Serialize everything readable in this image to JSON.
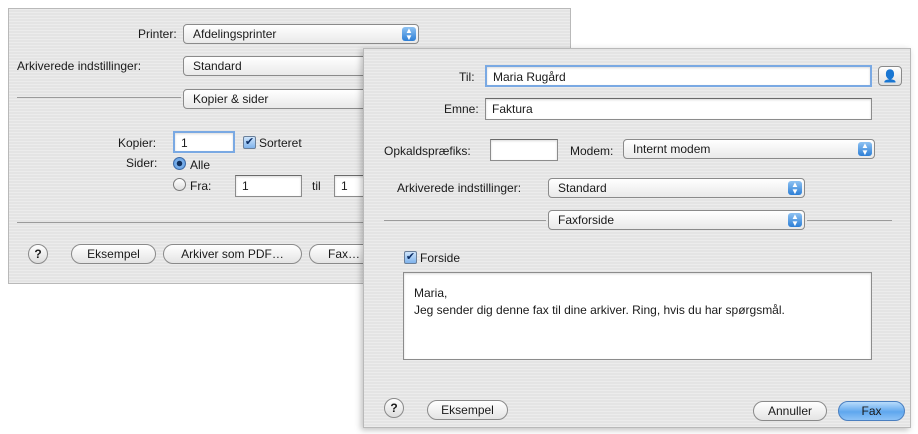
{
  "print_dialog": {
    "printer_label": "Printer:",
    "printer_value": "Afdelingsprinter",
    "presets_label": "Arkiverede indstillinger:",
    "presets_value": "Standard",
    "pane_value": "Kopier & sider",
    "copies_label": "Kopier:",
    "copies_value": "1",
    "collated_label": "Sorteret",
    "pages_label": "Sider:",
    "pages_all_label": "Alle",
    "pages_from_label": "Fra:",
    "pages_from_value": "1",
    "pages_to_label": "til",
    "pages_to_value": "1",
    "help_label": "?",
    "preview_button": "Eksempel",
    "save_pdf_button": "Arkiver som PDF…",
    "fax_button": "Fax…"
  },
  "fax_dialog": {
    "to_label": "Til:",
    "to_value": "Maria Rugård",
    "subject_label": "Emne:",
    "subject_value": "Faktura",
    "dial_prefix_label": "Opkaldspræfiks:",
    "dial_prefix_value": "",
    "modem_label": "Modem:",
    "modem_value": "Internt modem",
    "presets_label": "Arkiverede indstillinger:",
    "presets_value": "Standard",
    "pane_value": "Faxforside",
    "cover_label": "Forside",
    "cover_text_line1": "Maria,",
    "cover_text_line2": "Jeg sender dig denne fax til dine arkiver. Ring, hvis du har spørgsmål.",
    "help_label": "?",
    "preview_button": "Eksempel",
    "cancel_button": "Annuller",
    "fax_button": "Fax"
  },
  "icons": {
    "popup_arrows": "up-down-arrows-icon",
    "address_book": "address-book-icon",
    "checkmark": "checkmark-icon"
  },
  "colors": {
    "accent": "#5fa7ee",
    "focus_ring": "#7aa9e3"
  }
}
